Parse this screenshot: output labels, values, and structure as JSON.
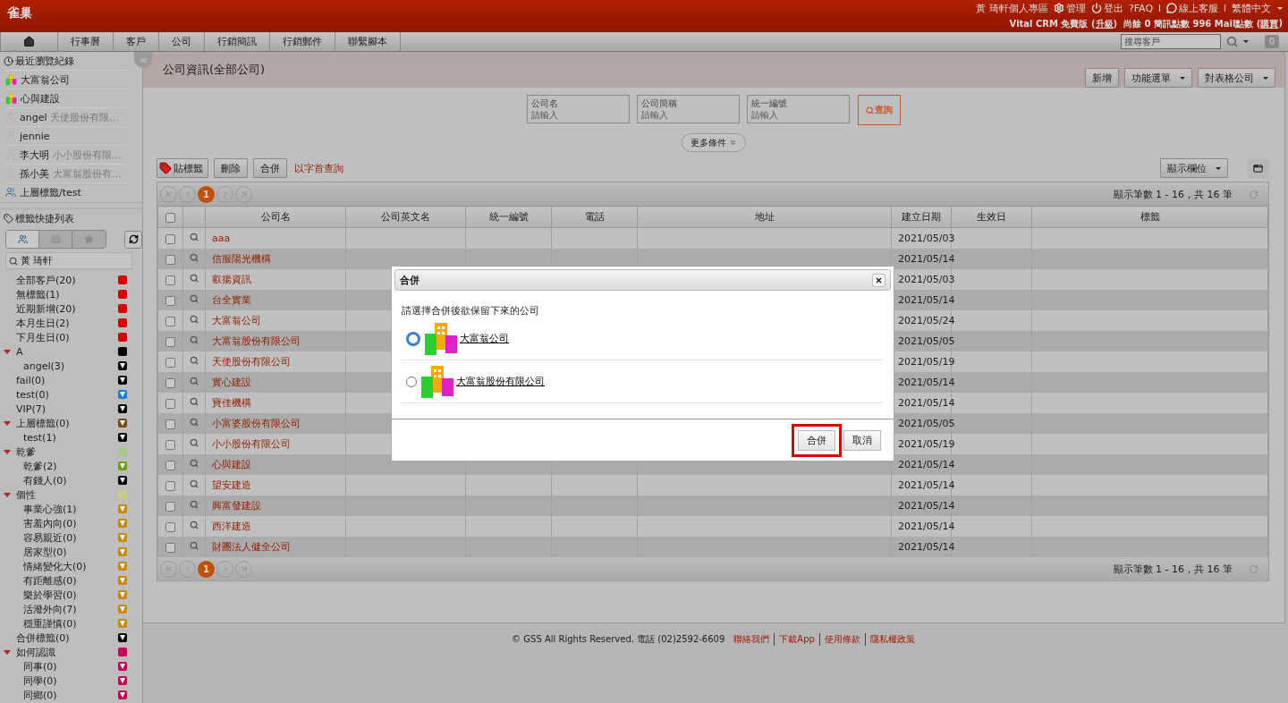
{
  "header": {
    "logo": "雀巢",
    "user_links": [
      {
        "kind": "text",
        "label": "黃 琦軒個人專區"
      },
      {
        "kind": "gear",
        "label": "管理"
      },
      {
        "kind": "power",
        "label": "登出"
      },
      {
        "kind": "text",
        "label": "?FAQ"
      },
      {
        "kind": "separator",
        "label": "I"
      },
      {
        "kind": "chat",
        "label": "線上客服"
      },
      {
        "kind": "separator",
        "label": "I"
      },
      {
        "kind": "dropdown",
        "label": "繁體中文"
      }
    ],
    "account_line": [
      {
        "kind": "text",
        "label": "Vital CRM 免費版 ("
      },
      {
        "kind": "link",
        "label": "升級"
      },
      {
        "kind": "text",
        "label": ")  尚餘 0 簡訊點數 996 Mail點數 ("
      },
      {
        "kind": "link",
        "label": "購買"
      },
      {
        "kind": "text",
        "label": ")"
      }
    ]
  },
  "nav": {
    "tabs": [
      {
        "kind": "home"
      },
      {
        "kind": "text",
        "label": "行事曆"
      },
      {
        "kind": "text",
        "label": "客戶"
      },
      {
        "kind": "text",
        "label": "公司"
      },
      {
        "kind": "text",
        "label": "行銷簡訊"
      },
      {
        "kind": "text",
        "label": "行銷郵件"
      },
      {
        "kind": "text",
        "label": "聯繫腳本"
      }
    ],
    "search": {
      "placeholder": "搜尋客戶"
    },
    "badge": "0"
  },
  "sidebar": {
    "recent": {
      "title": "最近瀏覽紀錄",
      "items": [
        {
          "kind": "company",
          "name": "大富翁公司"
        },
        {
          "kind": "company",
          "name": "心與建設"
        },
        {
          "kind": "person",
          "name": "angel",
          "sub": "天使股份有限…"
        },
        {
          "kind": "person",
          "name": "jennie"
        },
        {
          "kind": "person",
          "name": "李大明",
          "sub": "小小股份有限…"
        },
        {
          "kind": "person",
          "name": "孫小美",
          "sub": "大富翁股份有…"
        },
        {
          "kind": "tag",
          "name": "上層標籤/test"
        }
      ]
    },
    "tags": {
      "title": "標籤快捷列表",
      "filters": [
        {
          "kind": "people",
          "selected": true
        },
        {
          "kind": "company",
          "selected": false
        },
        {
          "kind": "star",
          "selected": false
        }
      ],
      "search": {
        "value": "黃 琦軒"
      },
      "items": [
        {
          "label": "全部客戶(20)",
          "kind": "square",
          "color": "#d40000"
        },
        {
          "label": "無標籤(1)",
          "kind": "square",
          "color": "#d40000"
        },
        {
          "label": "近期新增(20)",
          "kind": "square",
          "color": "#d40000"
        },
        {
          "label": "本月生日(2)",
          "kind": "square",
          "color": "#d40000"
        },
        {
          "label": "下月生日(0)",
          "kind": "square",
          "color": "#d40000"
        },
        {
          "label": "A",
          "kind": "square",
          "color": "#000000",
          "expanded": true,
          "children": [
            {
              "label": "angel(3)",
              "kind": "arrow",
              "color": "#000000"
            }
          ]
        },
        {
          "label": "fail(0)",
          "kind": "arrow",
          "color": "#000000"
        },
        {
          "label": "test(0)",
          "kind": "arrow",
          "color": "#1a7fd4"
        },
        {
          "label": "VIP(7)",
          "kind": "arrow",
          "color": "#000000"
        },
        {
          "label": "上層標籤(0)",
          "kind": "arrow",
          "color": "#7a4a1c",
          "expanded": true,
          "children": [
            {
              "label": "test(1)",
              "kind": "arrow",
              "color": "#000000"
            }
          ]
        },
        {
          "label": "乾爹",
          "kind": "square",
          "color": "#a6c98a",
          "expanded": true,
          "children": [
            {
              "label": "乾爹(2)",
              "kind": "arrow",
              "color": "#6aa10e"
            },
            {
              "label": "有錢人(0)",
              "kind": "arrow",
              "color": "#000000"
            }
          ]
        },
        {
          "label": "個性",
          "kind": "square",
          "color": "#cccc8a",
          "expanded": true,
          "children": [
            {
              "label": "事業心強(1)",
              "kind": "arrow",
              "color": "#c98a00"
            },
            {
              "label": "害羞內向(0)",
              "kind": "arrow",
              "color": "#c98a00"
            },
            {
              "label": "容易親近(0)",
              "kind": "arrow",
              "color": "#c98a00"
            },
            {
              "label": "居家型(0)",
              "kind": "arrow",
              "color": "#c98a00"
            },
            {
              "label": "情緒變化大(0)",
              "kind": "arrow",
              "color": "#c98a00"
            },
            {
              "label": "有距離感(0)",
              "kind": "arrow",
              "color": "#c98a00"
            },
            {
              "label": "樂於學習(0)",
              "kind": "arrow",
              "color": "#c98a00"
            },
            {
              "label": "活潑外向(7)",
              "kind": "arrow",
              "color": "#c98a00"
            },
            {
              "label": "穩重謹慎(0)",
              "kind": "arrow",
              "color": "#c98a00"
            }
          ]
        },
        {
          "label": "合併標籤(0)",
          "kind": "arrow",
          "color": "#000000"
        },
        {
          "label": "如何認識",
          "kind": "square",
          "color": "#c8005a",
          "expanded": true,
          "children": [
            {
              "label": "同事(0)",
              "kind": "arrow",
              "color": "#c8005a"
            },
            {
              "label": "同學(0)",
              "kind": "arrow",
              "color": "#c8005a"
            },
            {
              "label": "同鄉(0)",
              "kind": "arrow",
              "color": "#c8005a"
            }
          ]
        }
      ]
    }
  },
  "main": {
    "title": "公司資訊(全部公司)",
    "actions": [
      {
        "label": "新增",
        "dropdown": false
      },
      {
        "label": "功能選單",
        "dropdown": true
      },
      {
        "label": "對表格公司",
        "dropdown": true
      }
    ],
    "filters": [
      {
        "label": "公司名",
        "placeholder": "請輸入"
      },
      {
        "label": "公司簡稱",
        "placeholder": "請輸入"
      },
      {
        "label": "統一編號",
        "placeholder": "請輸入"
      }
    ],
    "query_button": "查詢",
    "more_button": "更多條件",
    "toolbar": [
      {
        "kind": "tag",
        "label": "貼標籤"
      },
      {
        "kind": "plain",
        "label": "刪除"
      },
      {
        "kind": "plain",
        "label": "合併"
      }
    ],
    "letter_link": "以字首查詢",
    "columns_button": "顯示欄位",
    "pagers": [
      {
        "page": "1",
        "summary": "顯示筆數 1 - 16，共 16 筆"
      },
      {
        "page": "1",
        "summary": "顯示筆數 1 - 16，共 16 筆"
      }
    ],
    "table": {
      "select_all_checked": false,
      "columns": [
        "公司名",
        "公司英文名",
        "統一編號",
        "電話",
        "地址",
        "建立日期",
        "生效日",
        "標籤"
      ],
      "rows": [
        {
          "name": "aaa",
          "created": "2021/05/03",
          "checked": false
        },
        {
          "name": "信服陽光機構",
          "created": "2021/05/14",
          "checked": false
        },
        {
          "name": "叡揚資訊",
          "created": "2021/05/03",
          "checked": false
        },
        {
          "name": "台全實業",
          "created": "2021/05/14",
          "checked": false
        },
        {
          "name": "大富翁公司",
          "created": "2021/05/24",
          "checked": false
        },
        {
          "name": "大富翁股份有限公司",
          "created": "2021/05/05",
          "checked": false
        },
        {
          "name": "天使股份有限公司",
          "created": "2021/05/19",
          "checked": false
        },
        {
          "name": "實心建設",
          "created": "2021/05/14",
          "checked": false
        },
        {
          "name": "寶佳機構",
          "created": "2021/05/14",
          "checked": false
        },
        {
          "name": "小富婆股份有限公司",
          "created": "2021/05/05",
          "checked": false
        },
        {
          "name": "小小股份有限公司",
          "created": "2021/05/19",
          "checked": false
        },
        {
          "name": "心與建設",
          "created": "2021/05/14",
          "checked": false
        },
        {
          "name": "望安建造",
          "created": "2021/05/14",
          "checked": false
        },
        {
          "name": "興富發建設",
          "created": "2021/05/14",
          "checked": false
        },
        {
          "name": "西洋建造",
          "created": "2021/05/14",
          "checked": false
        },
        {
          "name": "財團法人健全公司",
          "created": "2021/05/14",
          "checked": false
        }
      ]
    }
  },
  "dialog": {
    "title": "合併",
    "prompt": "請選擇合併後欲保留下來的公司",
    "options": [
      {
        "label": "大富翁公司",
        "selected": true
      },
      {
        "label": "大富翁股份有限公司",
        "selected": false
      }
    ],
    "buttons": [
      {
        "label": "合併",
        "highlighted": true
      },
      {
        "label": "取消",
        "highlighted": false
      }
    ]
  },
  "footer": {
    "text": "© GSS All Rights Reserved. 電話 (02)2592-6609",
    "links": [
      "聯絡我們",
      "下載App",
      "使用條款",
      "隱私權政策"
    ]
  }
}
